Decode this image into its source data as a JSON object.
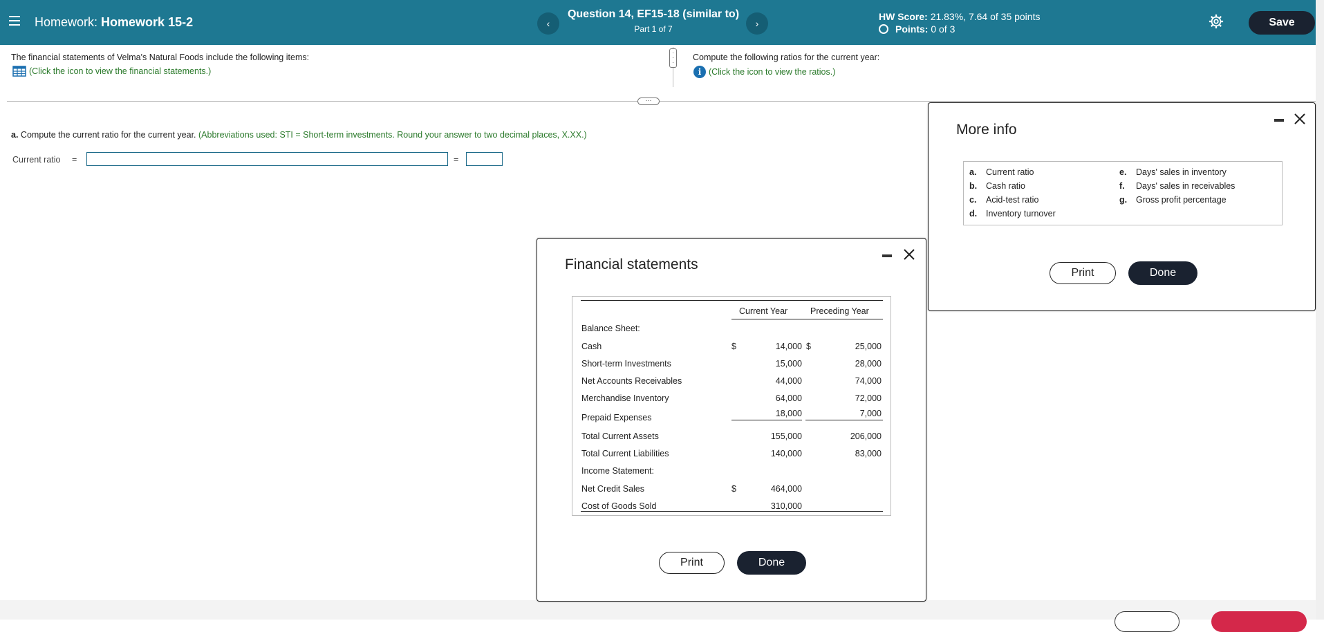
{
  "header": {
    "homework_prefix": "Homework:",
    "homework_name": "Homework 15-2",
    "question_title": "Question 14, EF15-18 (similar to)",
    "part": "Part 1 of 7",
    "prev": "‹",
    "next": "›",
    "hw_score_label": "HW Score:",
    "hw_score_value": "21.83%, 7.64 of 35 points",
    "points_label": "Points:",
    "points_value": "0 of 3",
    "save_label": "Save"
  },
  "colors": {
    "header_bg": "#1e7892",
    "dark_button": "#1a2230",
    "hint_green": "#2b7a2b",
    "check_red": "#d4284a"
  },
  "left_panel": {
    "intro": "The financial statements of Velma's Natural Foods include the following items:",
    "link": "(Click the icon to view the financial statements.)"
  },
  "right_panel": {
    "intro": "Compute the following ratios for the current year:",
    "link": "(Click the icon to view the ratios.)"
  },
  "question": {
    "part_a_bold": "a.",
    "part_a_text": "Compute the current ratio for the current year.",
    "part_a_hint": "(Abbreviations used: STI = Short-term investments. Round your answer to two decimal places, X.XX.)",
    "current_ratio_label": "Current ratio",
    "eq": "="
  },
  "financial_dialog": {
    "title": "Financial statements",
    "col_current": "Current Year",
    "col_preceding": "Preceding Year",
    "rows": [
      {
        "label": "Balance Sheet:",
        "sym": "",
        "cur": "",
        "sym2": "",
        "pre": ""
      },
      {
        "label": "Cash",
        "sym": "$",
        "cur": "14,000",
        "sym2": "$",
        "pre": "25,000"
      },
      {
        "label": "Short-term Investments",
        "sym": "",
        "cur": "15,000",
        "sym2": "",
        "pre": "28,000"
      },
      {
        "label": "Net Accounts Receivables",
        "sym": "",
        "cur": "44,000",
        "sym2": "",
        "pre": "74,000"
      },
      {
        "label": "Merchandise Inventory",
        "sym": "",
        "cur": "64,000",
        "sym2": "",
        "pre": "72,000"
      },
      {
        "label": "Prepaid Expenses",
        "sym": "",
        "cur": "18,000",
        "sym2": "",
        "pre": "7,000"
      },
      {
        "label": "Total Current Assets",
        "sym": "",
        "cur": "155,000",
        "sym2": "",
        "pre": "206,000"
      },
      {
        "label": "Total Current Liabilities",
        "sym": "",
        "cur": "140,000",
        "sym2": "",
        "pre": "83,000"
      },
      {
        "label": "Income Statement:",
        "sym": "",
        "cur": "",
        "sym2": "",
        "pre": ""
      },
      {
        "label": "Net Credit Sales",
        "sym": "$",
        "cur": "464,000",
        "sym2": "",
        "pre": ""
      },
      {
        "label": "Cost of Goods Sold",
        "sym": "",
        "cur": "310,000",
        "sym2": "",
        "pre": ""
      }
    ],
    "print_label": "Print",
    "done_label": "Done"
  },
  "more_info_dialog": {
    "title": "More info",
    "left_items": [
      {
        "letter": "a.",
        "text": "Current ratio"
      },
      {
        "letter": "b.",
        "text": "Cash ratio"
      },
      {
        "letter": "c.",
        "text": "Acid-test ratio"
      },
      {
        "letter": "d.",
        "text": "Inventory turnover"
      }
    ],
    "right_items": [
      {
        "letter": "e.",
        "text": "Days' sales in inventory"
      },
      {
        "letter": "f.",
        "text": "Days' sales in receivables"
      },
      {
        "letter": "g.",
        "text": "Gross profit percentage"
      }
    ],
    "print_label": "Print",
    "done_label": "Done"
  },
  "icons": {
    "menu": "hamburger-icon",
    "settings": "gear-icon",
    "statements": "table-grid-icon",
    "info": "info-circle-icon",
    "minimize": "minimize-icon",
    "close": "close-x-icon"
  }
}
